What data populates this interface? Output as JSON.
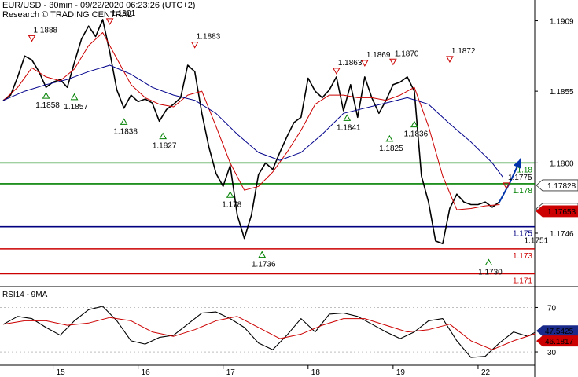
{
  "header": {
    "title": "EUR/USD - 30min - 09/22/2020 06:23:26 (UTC+2)",
    "subtitle": "Research © TRADING CENTRAL"
  },
  "colors": {
    "price": "#000000",
    "ma_fast": "#cc0000",
    "ma_slow": "#00008b",
    "support_green": "#008000",
    "pivot_navy": "#000080",
    "resistance_red": "#cc0000",
    "arrow": "#0033aa",
    "rsi": "#000000",
    "rsi_ma": "#cc0000",
    "badge_rsi_bg": "#1a2a8a",
    "badge_red_bg": "#cc0000",
    "badge_blue_bg": "#1a2a8a"
  },
  "chart_data": [
    {
      "type": "line",
      "panel": "price",
      "ylim": [
        1.1705,
        1.1925
      ],
      "yticks": [
        "1.1909",
        "1.1855",
        "1.1800",
        "1.1746"
      ],
      "ytick_values": [
        1.1909,
        1.1855,
        1.18,
        1.1746
      ],
      "xticks": [
        "15",
        "16",
        "17",
        "18",
        "19",
        "22"
      ],
      "xtick_positions": [
        14,
        38,
        62,
        86,
        110,
        134
      ],
      "x_range": [
        -1,
        150
      ],
      "levels": [
        {
          "label": "1.18",
          "value": 1.18,
          "color": "#008000"
        },
        {
          "label": "1.178",
          "value": 1.1784,
          "color": "#008000"
        },
        {
          "label": "1.175",
          "value": 1.1751,
          "color": "#000080"
        },
        {
          "label": "1.173",
          "value": 1.1734,
          "color": "#cc0000"
        },
        {
          "label": "1.171",
          "value": 1.1715,
          "color": "#cc0000"
        }
      ],
      "price_badges": [
        {
          "label": "1.17828",
          "value": 1.17828,
          "style": "outline"
        },
        {
          "label": "1.1766",
          "value": 1.1766,
          "style": "outline"
        },
        {
          "label": "1.17653",
          "value": 1.17653,
          "style": "red"
        }
      ],
      "series": [
        {
          "name": "price",
          "x": [
            0,
            2,
            4,
            6,
            8,
            10,
            12,
            14,
            16,
            18,
            20,
            22,
            24,
            26,
            28,
            30,
            32,
            34,
            36,
            38,
            40,
            42,
            44,
            46,
            48,
            50,
            52,
            54,
            56,
            58,
            60,
            62,
            64,
            66,
            68,
            70,
            72,
            74,
            76,
            78,
            80,
            82,
            84,
            86,
            88,
            90,
            92,
            94,
            96,
            98,
            100,
            102,
            104,
            106,
            108,
            110,
            112,
            114,
            116,
            118,
            120,
            122,
            124,
            126,
            128,
            130,
            132,
            134,
            136,
            138,
            140
          ],
          "values": [
            1.1848,
            1.1852,
            1.1866,
            1.1882,
            1.1879,
            1.187,
            1.1858,
            1.1862,
            1.1864,
            1.1858,
            1.1877,
            1.1895,
            1.1905,
            1.1897,
            1.191,
            1.1885,
            1.1856,
            1.1842,
            1.1852,
            1.1847,
            1.1849,
            1.1846,
            1.1832,
            1.1841,
            1.1845,
            1.185,
            1.1875,
            1.187,
            1.1838,
            1.1812,
            1.1792,
            1.1782,
            1.1798,
            1.176,
            1.1742,
            1.176,
            1.1791,
            1.18,
            1.1795,
            1.1808,
            1.182,
            1.1831,
            1.1835,
            1.1865,
            1.1855,
            1.185,
            1.1856,
            1.1866,
            1.184,
            1.186,
            1.1835,
            1.1866,
            1.185,
            1.1838,
            1.1848,
            1.186,
            1.1862,
            1.1866,
            1.1855,
            1.179,
            1.177,
            1.174,
            1.1738,
            1.1765,
            1.1776,
            1.177,
            1.1768,
            1.1768,
            1.177,
            1.1766,
            1.177
          ]
        },
        {
          "name": "ma_fast",
          "x": [
            0,
            4,
            8,
            12,
            16,
            20,
            24,
            28,
            32,
            36,
            40,
            44,
            48,
            52,
            56,
            60,
            64,
            68,
            72,
            76,
            80,
            84,
            88,
            92,
            96,
            100,
            104,
            108,
            112,
            116,
            120,
            124,
            128,
            132,
            136,
            140
          ],
          "values": [
            1.1848,
            1.1858,
            1.1873,
            1.1866,
            1.1863,
            1.1872,
            1.189,
            1.19,
            1.188,
            1.186,
            1.185,
            1.1845,
            1.1843,
            1.1852,
            1.1855,
            1.1828,
            1.18,
            1.1779,
            1.1782,
            1.1793,
            1.1808,
            1.1825,
            1.1845,
            1.1852,
            1.1852,
            1.185,
            1.185,
            1.1848,
            1.1852,
            1.1858,
            1.1828,
            1.179,
            1.1764,
            1.1765,
            1.1767,
            1.1768
          ]
        },
        {
          "name": "ma_slow",
          "x": [
            0,
            6,
            12,
            18,
            24,
            30,
            36,
            42,
            48,
            54,
            60,
            66,
            72,
            78,
            84,
            90,
            96,
            102,
            108,
            114,
            120,
            126,
            132,
            138,
            141
          ],
          "values": [
            1.1848,
            1.1855,
            1.186,
            1.1864,
            1.187,
            1.1875,
            1.1868,
            1.1858,
            1.1852,
            1.1848,
            1.1838,
            1.1822,
            1.1808,
            1.1802,
            1.1808,
            1.1822,
            1.1838,
            1.1842,
            1.1846,
            1.185,
            1.1845,
            1.183,
            1.1816,
            1.18,
            1.1789
          ]
        },
        {
          "name": "projection",
          "x": [
            140,
            143,
            146
          ],
          "values": [
            1.177,
            1.1785,
            1.1803
          ]
        }
      ],
      "annotations": [
        {
          "x": 8,
          "label": "1.1888",
          "kind": "high",
          "value": 1.1888
        },
        {
          "x": 30,
          "label": "1.1901",
          "kind": "high",
          "value": 1.1901
        },
        {
          "x": 54,
          "label": "1.1883",
          "kind": "high",
          "value": 1.1883
        },
        {
          "x": 94,
          "label": "1.1863",
          "kind": "high",
          "value": 1.1863
        },
        {
          "x": 102,
          "label": "1.1869",
          "kind": "high",
          "value": 1.1869
        },
        {
          "x": 110,
          "label": "1.1870",
          "kind": "high",
          "value": 1.187
        },
        {
          "x": 126,
          "label": "1.1872",
          "kind": "high",
          "value": 1.1872
        },
        {
          "x": 142,
          "label": "1.1775",
          "kind": "high",
          "value": 1.1775
        },
        {
          "x": 12,
          "label": "1.1858",
          "kind": "low",
          "value": 1.1858
        },
        {
          "x": 20,
          "label": "1.1857",
          "kind": "low",
          "value": 1.1857
        },
        {
          "x": 34,
          "label": "1.1838",
          "kind": "low",
          "value": 1.1838
        },
        {
          "x": 45,
          "label": "1.1827",
          "kind": "low",
          "value": 1.1827
        },
        {
          "x": 64,
          "label": "1.178",
          "kind": "low",
          "value": 1.1782
        },
        {
          "x": 73,
          "label": "1.1736",
          "kind": "low",
          "value": 1.1736
        },
        {
          "x": 97,
          "label": "1.1841",
          "kind": "low",
          "value": 1.1841
        },
        {
          "x": 109,
          "label": "1.1825",
          "kind": "low",
          "value": 1.1825
        },
        {
          "x": 116,
          "label": "1.1836",
          "kind": "low",
          "value": 1.1836
        },
        {
          "x": 137,
          "label": "1.1730",
          "kind": "low",
          "value": 1.173
        },
        {
          "x": 147,
          "label": "1.1751",
          "kind": "text",
          "value": 1.1751
        }
      ]
    },
    {
      "type": "line",
      "panel": "rsi",
      "title": "RSI14 - 9MA",
      "ylim": [
        18,
        88
      ],
      "yticks": [
        "70",
        "30"
      ],
      "ytick_values": [
        70,
        30
      ],
      "levels": [
        70,
        30
      ],
      "badges": [
        {
          "label": "47.5425",
          "value": 47.5425,
          "style": "blue"
        },
        {
          "label": "46.1817",
          "value": 46.1817,
          "style": "red"
        }
      ],
      "series": [
        {
          "name": "RSI14",
          "x": [
            0,
            4,
            8,
            12,
            16,
            20,
            24,
            28,
            32,
            36,
            40,
            44,
            48,
            52,
            56,
            60,
            64,
            68,
            72,
            76,
            80,
            84,
            88,
            92,
            96,
            100,
            104,
            108,
            112,
            116,
            120,
            124,
            128,
            132,
            136,
            140,
            144,
            148,
            150
          ],
          "values": [
            55,
            62,
            60,
            52,
            45,
            58,
            68,
            71,
            58,
            40,
            37,
            43,
            45,
            55,
            65,
            66,
            60,
            52,
            38,
            32,
            45,
            60,
            48,
            64,
            65,
            62,
            55,
            48,
            42,
            48,
            58,
            60,
            40,
            25,
            26,
            38,
            48,
            44,
            47.5
          ]
        },
        {
          "name": "9MA",
          "x": [
            0,
            6,
            12,
            18,
            24,
            30,
            36,
            42,
            48,
            54,
            60,
            66,
            72,
            78,
            84,
            90,
            96,
            102,
            108,
            114,
            120,
            126,
            132,
            138,
            144,
            150
          ],
          "values": [
            55,
            58,
            58,
            54,
            56,
            61,
            58,
            48,
            44,
            50,
            58,
            62,
            52,
            42,
            46,
            54,
            60,
            60,
            54,
            48,
            50,
            55,
            40,
            32,
            40,
            46.2
          ]
        }
      ]
    }
  ]
}
